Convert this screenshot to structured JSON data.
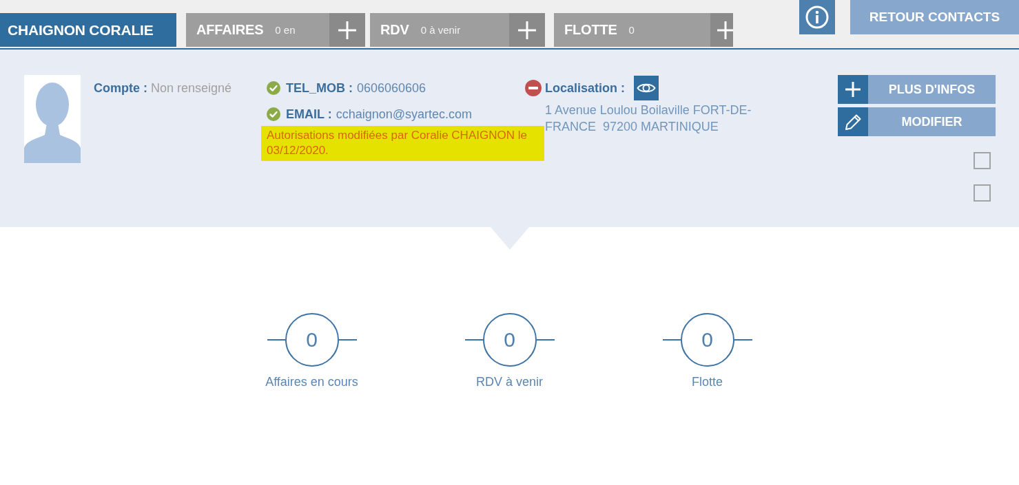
{
  "tabs": [
    {
      "kind": "contact",
      "label": "CHAIGNON CORALIE",
      "selected": true
    },
    {
      "kind": "module",
      "label": "AFFAIRES",
      "count": "0 en",
      "selected": false
    },
    {
      "kind": "module",
      "label": "RDV",
      "count": "0 à venir",
      "selected": false
    },
    {
      "kind": "module",
      "label": "FLOTTE",
      "count": "0",
      "selected": false
    }
  ],
  "header_actions": {
    "back_button": "RETOUR CONTACTS"
  },
  "contact": {
    "account": {
      "label": "Compte :",
      "value": "Non renseigné"
    },
    "channels": [
      {
        "label": "TEL_MOB :",
        "value": "0606060606",
        "verified": true
      },
      {
        "label": "EMAIL :",
        "value": "cchaignon@syartec.com",
        "verified": true
      }
    ],
    "notice": "Autorisations modifiées par Coralie CHAIGNON le 03/12/2020.",
    "location": {
      "label": "Localisation :",
      "verified": false,
      "address": "1 Avenue Loulou Boilaville FORT-DE-FRANCE  97200 MARTINIQUE"
    }
  },
  "actions": [
    {
      "kind": "more",
      "label": "PLUS D'INFOS"
    },
    {
      "kind": "edit",
      "label": "MODIFIER"
    }
  ],
  "checkboxes": [
    {
      "checked": false
    },
    {
      "checked": false
    }
  ],
  "stats": [
    {
      "value": "0",
      "label": "Affaires en cours"
    },
    {
      "value": "0",
      "label": "RDV à venir"
    },
    {
      "value": "0",
      "label": "Flotte"
    }
  ]
}
